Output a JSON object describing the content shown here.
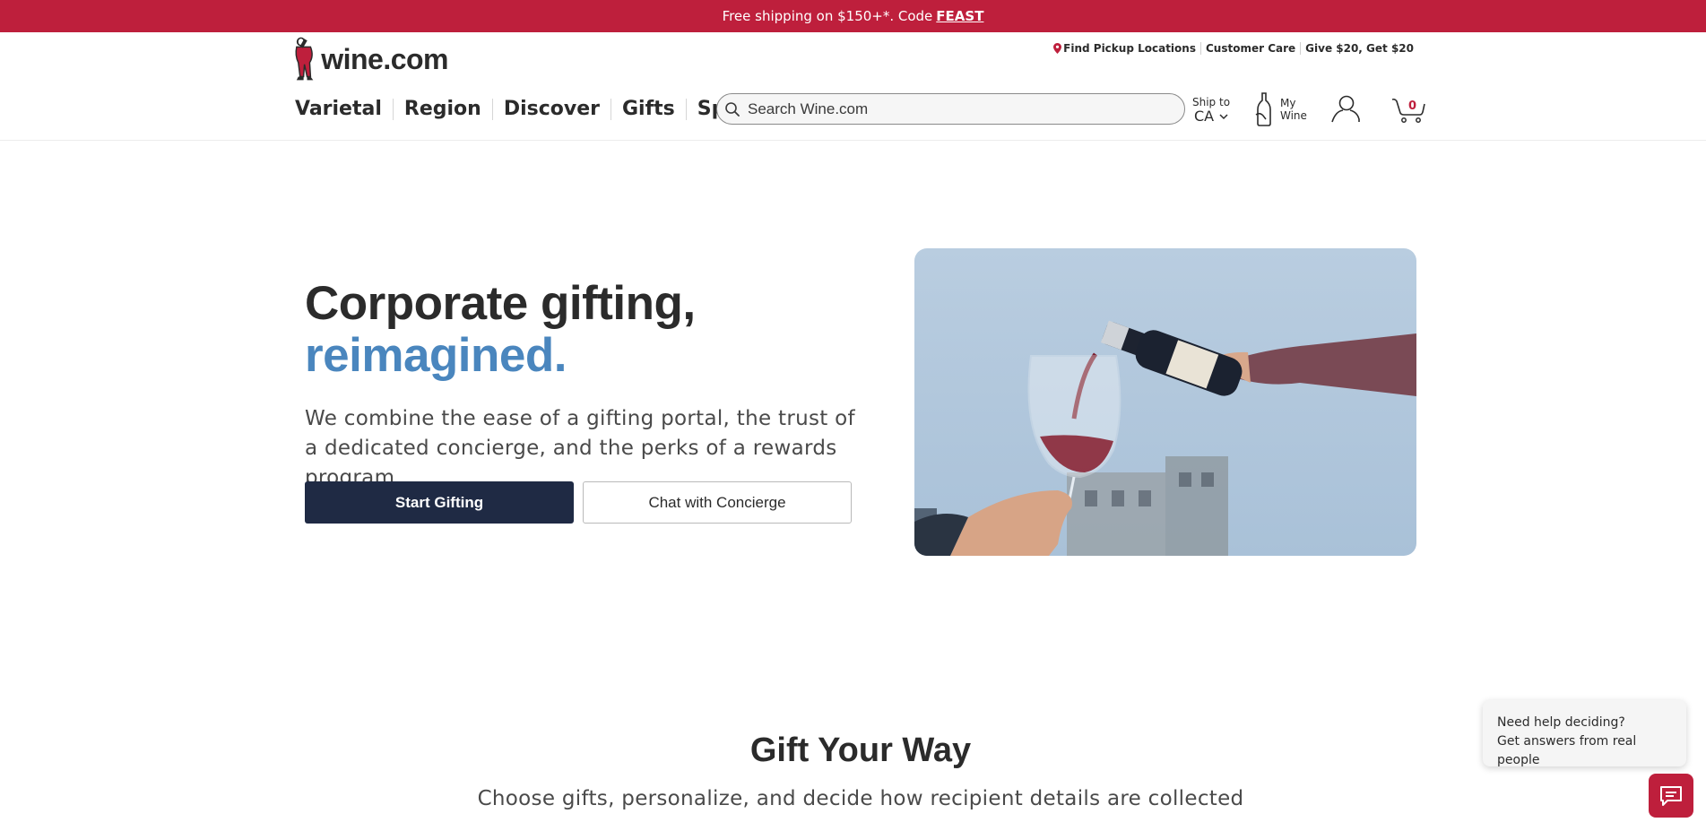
{
  "promo": {
    "text": "Free shipping on $150+*. Code",
    "code": "FEAST"
  },
  "brand": {
    "name": "wine.com"
  },
  "utility": {
    "pickup": "Find Pickup Locations",
    "care": "Customer Care",
    "give": "Give $20, Get $20"
  },
  "nav": {
    "items": [
      "Varietal",
      "Region",
      "Discover",
      "Gifts",
      "Spirits"
    ]
  },
  "search": {
    "placeholder": "Search Wine.com"
  },
  "shipto": {
    "label": "Ship to",
    "value": "CA"
  },
  "mywine": {
    "label_line1": "My",
    "label_line2": "Wine"
  },
  "cart": {
    "count": "0"
  },
  "hero": {
    "title_line1": "Corporate gifting,",
    "title_line2": "reimagined.",
    "subtitle": "We combine the ease of a gifting portal, the trust of a dedicated concierge, and the perks of a rewards program.",
    "primary_cta": "Start Gifting",
    "secondary_cta": "Chat with Concierge"
  },
  "section": {
    "title": "Gift Your Way",
    "subtitle": "Choose gifts, personalize, and decide how recipient details are collected"
  },
  "chat": {
    "line1": "Need help deciding?",
    "line2": "Get answers from real people"
  },
  "colors": {
    "brand_red": "#be1f3c",
    "accent_blue": "#4a86be",
    "navy": "#1f2a44"
  }
}
